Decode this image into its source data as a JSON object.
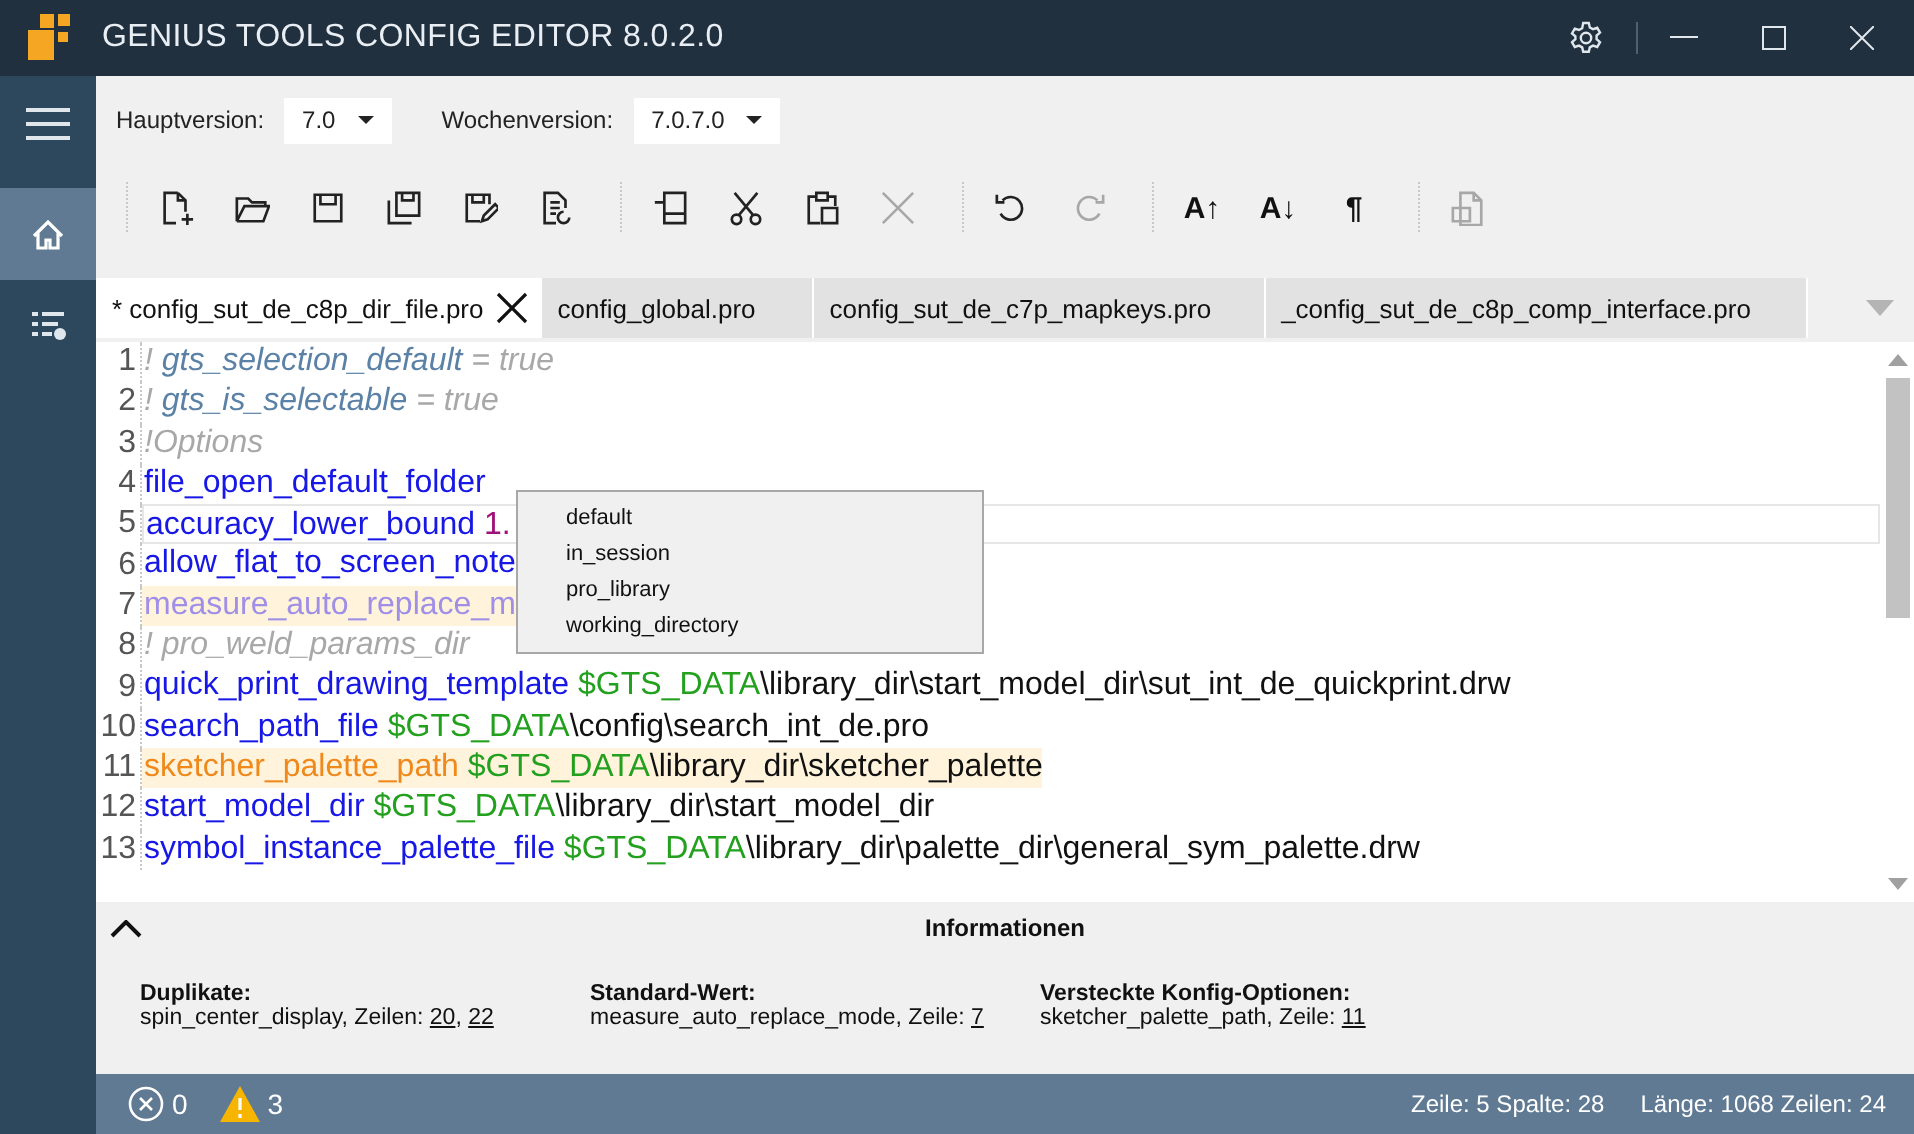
{
  "window": {
    "title": "GENIUS TOOLS CONFIG EDITOR 8.0.2.0"
  },
  "sidebar": {
    "items": [
      {
        "kind": "menu",
        "selected": false
      },
      {
        "kind": "home",
        "selected": true
      },
      {
        "kind": "list-settings",
        "selected": false
      }
    ]
  },
  "versions": [
    {
      "label": "Hauptversion:",
      "value": "7.0"
    },
    {
      "label": "Wochenversion:",
      "value": "7.0.7.0"
    }
  ],
  "toolbar": [
    [
      {
        "kind": "new-file",
        "disabled": false
      },
      {
        "kind": "open-folder",
        "disabled": false
      },
      {
        "kind": "save",
        "disabled": false
      },
      {
        "kind": "save-all",
        "disabled": false
      },
      {
        "kind": "save-edit",
        "disabled": false
      },
      {
        "kind": "file-compare",
        "disabled": false
      }
    ],
    [
      {
        "kind": "copy",
        "disabled": false
      },
      {
        "kind": "cut",
        "disabled": false
      },
      {
        "kind": "paste",
        "disabled": false
      },
      {
        "kind": "delete",
        "disabled": true
      }
    ],
    [
      {
        "kind": "undo",
        "disabled": false
      },
      {
        "kind": "redo",
        "disabled": true
      }
    ],
    [
      {
        "kind": "text",
        "label": "A↑",
        "disabled": false
      },
      {
        "kind": "text",
        "label": "A↓",
        "disabled": false
      },
      {
        "kind": "text",
        "label": "¶",
        "disabled": false
      }
    ],
    [
      {
        "kind": "sut-file",
        "disabled": true
      }
    ]
  ],
  "tabs": [
    {
      "label": "* config_sut_de_c8p_dir_file.pro",
      "selected": true
    },
    {
      "label": "config_global.pro",
      "selected": false
    },
    {
      "label": "config_sut_de_c7p_mapkeys.pro",
      "selected": false
    },
    {
      "label": "_config_sut_de_c8p_comp_interface.pro",
      "selected": false
    }
  ],
  "editor": {
    "lines": [
      {
        "number": "1",
        "current": false,
        "warning": false,
        "tokens": [
          {
            "kind": "comment",
            "text": "! "
          },
          {
            "kind": "comment-key",
            "text": "gts_selection_default"
          },
          {
            "kind": "comment",
            "text": " = true"
          }
        ]
      },
      {
        "number": "2",
        "current": false,
        "warning": false,
        "tokens": [
          {
            "kind": "comment",
            "text": "! "
          },
          {
            "kind": "comment-key",
            "text": "gts_is_selectable"
          },
          {
            "kind": "comment",
            "text": " = true"
          }
        ]
      },
      {
        "number": "3",
        "current": false,
        "warning": false,
        "tokens": [
          {
            "kind": "comment",
            "text": "!Options"
          }
        ]
      },
      {
        "number": "4",
        "current": false,
        "warning": false,
        "tokens": [
          {
            "kind": "key",
            "text": "file_open_default_folder"
          }
        ]
      },
      {
        "number": "5",
        "current": true,
        "warning": false,
        "tokens": [
          {
            "kind": "key",
            "text": "accuracy_lower_bound"
          },
          {
            "kind": "number",
            "text": " 1."
          }
        ]
      },
      {
        "number": "6",
        "current": false,
        "warning": false,
        "tokens": [
          {
            "kind": "key",
            "text": "allow_flat_to_screen_note"
          }
        ]
      },
      {
        "number": "7",
        "current": false,
        "warning": true,
        "tokens": [
          {
            "kind": "default-key",
            "text": "measure_auto_replace_m"
          }
        ]
      },
      {
        "number": "8",
        "current": false,
        "warning": false,
        "tokens": [
          {
            "kind": "comment",
            "text": "! pro_weld_params_dir"
          }
        ]
      },
      {
        "number": "9",
        "current": false,
        "warning": false,
        "tokens": [
          {
            "kind": "key",
            "text": "quick_print_drawing_template"
          },
          {
            "kind": "var",
            "text": " $GTS_DATA"
          },
          {
            "kind": "path",
            "text": "\\library_dir\\start_model_dir\\sut_int_de_quickprint.drw"
          }
        ]
      },
      {
        "number": "10",
        "current": false,
        "warning": false,
        "tokens": [
          {
            "kind": "key",
            "text": "search_path_file"
          },
          {
            "kind": "var",
            "text": " $GTS_DATA"
          },
          {
            "kind": "path",
            "text": "\\config\\search_int_de.pro"
          }
        ]
      },
      {
        "number": "11",
        "current": false,
        "warning": true,
        "tokens": [
          {
            "kind": "hidden-key",
            "text": "sketcher_palette_path"
          },
          {
            "kind": "var",
            "text": " $GTS_DATA"
          },
          {
            "kind": "path",
            "text": "\\library_dir\\sketcher_palette"
          }
        ]
      },
      {
        "number": "12",
        "current": false,
        "warning": false,
        "tokens": [
          {
            "kind": "key",
            "text": "start_model_dir"
          },
          {
            "kind": "var",
            "text": " $GTS_DATA"
          },
          {
            "kind": "path",
            "text": "\\library_dir\\start_model_dir"
          }
        ]
      },
      {
        "number": "13",
        "current": false,
        "warning": false,
        "tokens": [
          {
            "kind": "key",
            "text": "symbol_instance_palette_file"
          },
          {
            "kind": "var",
            "text": " $GTS_DATA"
          },
          {
            "kind": "path",
            "text": "\\library_dir\\palette_dir\\general_sym_palette.drw"
          }
        ]
      }
    ],
    "completion": [
      "default",
      "in_session",
      "pro_library",
      "working_directory"
    ]
  },
  "info": {
    "title": "Informationen",
    "expanded": true,
    "sections": [
      {
        "heading": "Duplikate:",
        "parts": [
          {
            "kind": "text",
            "text": "spin_center_display, Zeilen: "
          },
          {
            "kind": "link",
            "text": "20"
          },
          {
            "kind": "text",
            "text": ", "
          },
          {
            "kind": "link",
            "text": "22"
          }
        ]
      },
      {
        "heading": "Standard-Wert:",
        "parts": [
          {
            "kind": "text",
            "text": "measure_auto_replace_mode, Zeile: "
          },
          {
            "kind": "link",
            "text": "7"
          }
        ]
      },
      {
        "heading": "Versteckte Konfig-Optionen:",
        "parts": [
          {
            "kind": "text",
            "text": "sketcher_palette_path, Zeile: "
          },
          {
            "kind": "link",
            "text": "11"
          }
        ]
      }
    ]
  },
  "status_bar": {
    "errors": "0",
    "warnings": "3",
    "position": "Zeile: 5 Spalte: 28",
    "length": "Länge: 1068 Zeilen: 24"
  }
}
